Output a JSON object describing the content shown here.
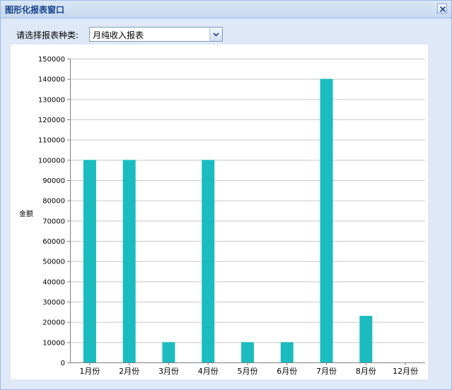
{
  "window": {
    "title": "图形化报表窗口",
    "close_icon": "close-icon"
  },
  "toolbar": {
    "report_type_label": "请选择报表种类:",
    "report_type_value": "月纯收入报表",
    "dropdown_icon": "chevron-down-icon"
  },
  "colors": {
    "bar": "#1bbcc0",
    "grid": "#c8c8c8",
    "axis": "#808080"
  },
  "chart_data": {
    "type": "bar",
    "categories": [
      "1月份",
      "2月份",
      "3月份",
      "4月份",
      "5月份",
      "6月份",
      "7月份",
      "8月份",
      "12月份"
    ],
    "values": [
      100000,
      100000,
      10000,
      100000,
      10000,
      10000,
      140000,
      23000,
      0
    ],
    "ylabel": "金额",
    "ylim": [
      0,
      150000
    ],
    "yticks": [
      0,
      10000,
      20000,
      30000,
      40000,
      50000,
      60000,
      70000,
      80000,
      90000,
      100000,
      110000,
      120000,
      130000,
      140000,
      150000
    ],
    "grid": true
  }
}
